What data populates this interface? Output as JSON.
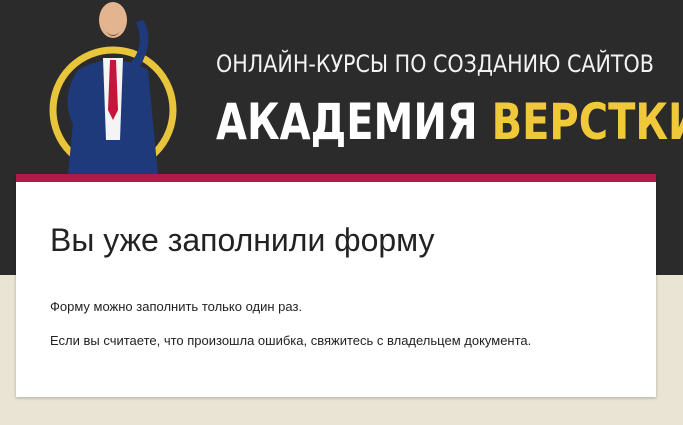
{
  "banner": {
    "subtitle": "ОНЛАЙН-КУРСЫ ПО СОЗДАНИЮ САЙТОВ",
    "title_part1": "АКАДЕМИЯ",
    "title_part2": "ВЕРСТКИ",
    "accent_color": "#f0c93a",
    "background_color": "#2b2b2b"
  },
  "form": {
    "heading": "Вы уже заполнили форму",
    "message1": "Форму можно заполнить только один раз.",
    "message2": "Если вы считаете, что произошла ошибка, свяжитесь с владельцем документа.",
    "accent_color": "#b2194b"
  }
}
